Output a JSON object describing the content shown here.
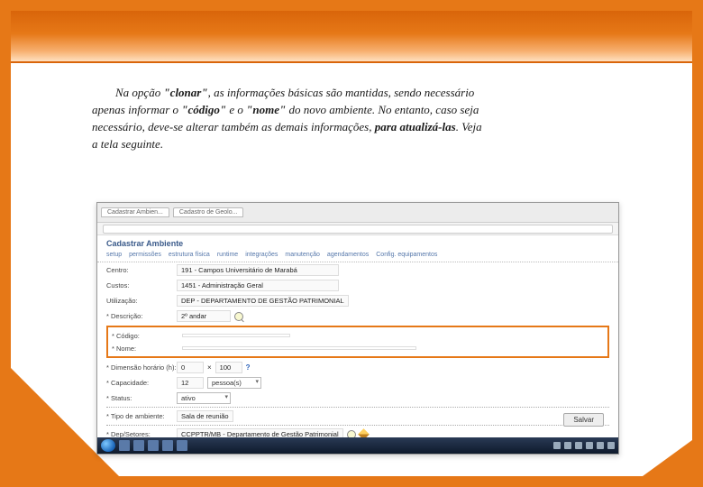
{
  "paragraph": {
    "pre": "Na opção ",
    "b1": "\"clonar\"",
    "mid1": ", as informações básicas são mantidas, sendo necessário apenas informar o ",
    "b2": "\"código\"",
    "mid2": " e o ",
    "b3": "\"nome\"",
    "mid3": " do novo ambiente. No entanto, caso seja necessário, deve-se alterar também as demais informações, ",
    "b4": "para atualizá-las",
    "post": ". Veja a tela seguinte."
  },
  "screenshot": {
    "tabs": [
      "Cadastrar Ambien...",
      "Cadastro de Geolo..."
    ],
    "page_heading": "Cadastrar Ambiente",
    "menu": [
      "setup",
      "permissões",
      "estrutura física",
      "runtime",
      "integrações",
      "manutenção",
      "agendamentos",
      "Config. equipamentos"
    ],
    "fields": {
      "centro_label": "Centro:",
      "centro_value": "191 - Campos Universitário de Marabá",
      "custos_label": "Custos:",
      "custos_value": "1451 - Administração Geral",
      "utilizacao_label": "Utilização:",
      "utilizacao_value": "DEP - DEPARTAMENTO DE GESTÃO PATRIMONIAL",
      "desc_label": "* Descrição:",
      "desc_value": "2º andar",
      "codigo_label": "* Código:",
      "nome_label": "* Nome:",
      "dimensao_label": "* Dimensão horário (h):",
      "dimensao_h": "0",
      "dimensao_m": "100",
      "capacidade_label": "* Capacidade:",
      "capacidade_val": "12",
      "pessoas": "pessoa(s)",
      "status_label": "* Status:",
      "status_val": "ativo",
      "reuniao_label": "* Tipo de ambiente:",
      "reuniao_val": "Sala de reunião",
      "dep_label": "* Dep/Setores:",
      "dep_val": "CCPPTR/MB - Departamento de Gestão Patrimonial"
    },
    "salvar": "Salvar"
  }
}
